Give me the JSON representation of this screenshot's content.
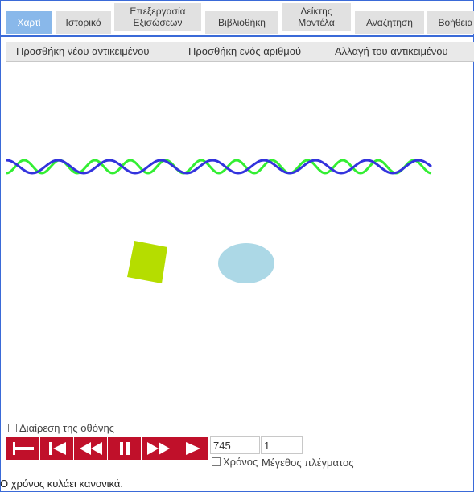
{
  "tabs": [
    {
      "label": "Χαρτί"
    },
    {
      "label": "Ιστορικό"
    },
    {
      "label": "Επεξεργασία\nΕξισώσεων"
    },
    {
      "label": "Βιβλιοθήκη"
    },
    {
      "label": "Δείκτης\nΜοντέλα"
    },
    {
      "label": "Αναζήτηση"
    },
    {
      "label": "Βοήθεια"
    }
  ],
  "toolbar": {
    "add_object": "Προσθήκη νέου αντικειμένου",
    "add_number": "Προσθήκη ενός αριθμού",
    "change_object": "Αλλαγή του αντικειμένου"
  },
  "canvas": {
    "wave_colors": {
      "green": "#33ee33",
      "blue": "#3333dd"
    },
    "square_color": "#b5dd00",
    "ellipse_color": "#acd8e6"
  },
  "controls": {
    "split_screen_label": "Διαίρεση της οθόνης",
    "buttons": [
      "go-to-start-icon",
      "step-back-icon",
      "rewind-icon",
      "pause-icon",
      "fast-forward-icon",
      "play-icon"
    ],
    "button_color": "#c0102a",
    "time_value": "745",
    "grid_value": "1",
    "time_checkbox_label": "Χρόνος",
    "grid_size_label": "Μέγεθος πλέγματος"
  },
  "status": {
    "message": "Ο χρόνος κυλάει κανονικά."
  }
}
